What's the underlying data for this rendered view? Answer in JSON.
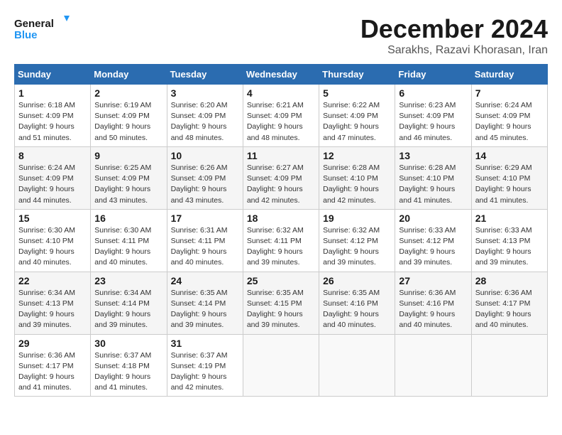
{
  "header": {
    "logo_line1": "General",
    "logo_line2": "Blue",
    "month": "December 2024",
    "location": "Sarakhs, Razavi Khorasan, Iran"
  },
  "weekdays": [
    "Sunday",
    "Monday",
    "Tuesday",
    "Wednesday",
    "Thursday",
    "Friday",
    "Saturday"
  ],
  "weeks": [
    [
      {
        "day": 1,
        "sunrise": "6:18 AM",
        "sunset": "4:09 PM",
        "daylight": "9 hours and 51 minutes."
      },
      {
        "day": 2,
        "sunrise": "6:19 AM",
        "sunset": "4:09 PM",
        "daylight": "9 hours and 50 minutes."
      },
      {
        "day": 3,
        "sunrise": "6:20 AM",
        "sunset": "4:09 PM",
        "daylight": "9 hours and 48 minutes."
      },
      {
        "day": 4,
        "sunrise": "6:21 AM",
        "sunset": "4:09 PM",
        "daylight": "9 hours and 48 minutes."
      },
      {
        "day": 5,
        "sunrise": "6:22 AM",
        "sunset": "4:09 PM",
        "daylight": "9 hours and 47 minutes."
      },
      {
        "day": 6,
        "sunrise": "6:23 AM",
        "sunset": "4:09 PM",
        "daylight": "9 hours and 46 minutes."
      },
      {
        "day": 7,
        "sunrise": "6:24 AM",
        "sunset": "4:09 PM",
        "daylight": "9 hours and 45 minutes."
      }
    ],
    [
      {
        "day": 8,
        "sunrise": "6:24 AM",
        "sunset": "4:09 PM",
        "daylight": "9 hours and 44 minutes."
      },
      {
        "day": 9,
        "sunrise": "6:25 AM",
        "sunset": "4:09 PM",
        "daylight": "9 hours and 43 minutes."
      },
      {
        "day": 10,
        "sunrise": "6:26 AM",
        "sunset": "4:09 PM",
        "daylight": "9 hours and 43 minutes."
      },
      {
        "day": 11,
        "sunrise": "6:27 AM",
        "sunset": "4:09 PM",
        "daylight": "9 hours and 42 minutes."
      },
      {
        "day": 12,
        "sunrise": "6:28 AM",
        "sunset": "4:10 PM",
        "daylight": "9 hours and 42 minutes."
      },
      {
        "day": 13,
        "sunrise": "6:28 AM",
        "sunset": "4:10 PM",
        "daylight": "9 hours and 41 minutes."
      },
      {
        "day": 14,
        "sunrise": "6:29 AM",
        "sunset": "4:10 PM",
        "daylight": "9 hours and 41 minutes."
      }
    ],
    [
      {
        "day": 15,
        "sunrise": "6:30 AM",
        "sunset": "4:10 PM",
        "daylight": "9 hours and 40 minutes."
      },
      {
        "day": 16,
        "sunrise": "6:30 AM",
        "sunset": "4:11 PM",
        "daylight": "9 hours and 40 minutes."
      },
      {
        "day": 17,
        "sunrise": "6:31 AM",
        "sunset": "4:11 PM",
        "daylight": "9 hours and 40 minutes."
      },
      {
        "day": 18,
        "sunrise": "6:32 AM",
        "sunset": "4:11 PM",
        "daylight": "9 hours and 39 minutes."
      },
      {
        "day": 19,
        "sunrise": "6:32 AM",
        "sunset": "4:12 PM",
        "daylight": "9 hours and 39 minutes."
      },
      {
        "day": 20,
        "sunrise": "6:33 AM",
        "sunset": "4:12 PM",
        "daylight": "9 hours and 39 minutes."
      },
      {
        "day": 21,
        "sunrise": "6:33 AM",
        "sunset": "4:13 PM",
        "daylight": "9 hours and 39 minutes."
      }
    ],
    [
      {
        "day": 22,
        "sunrise": "6:34 AM",
        "sunset": "4:13 PM",
        "daylight": "9 hours and 39 minutes."
      },
      {
        "day": 23,
        "sunrise": "6:34 AM",
        "sunset": "4:14 PM",
        "daylight": "9 hours and 39 minutes."
      },
      {
        "day": 24,
        "sunrise": "6:35 AM",
        "sunset": "4:14 PM",
        "daylight": "9 hours and 39 minutes."
      },
      {
        "day": 25,
        "sunrise": "6:35 AM",
        "sunset": "4:15 PM",
        "daylight": "9 hours and 39 minutes."
      },
      {
        "day": 26,
        "sunrise": "6:35 AM",
        "sunset": "4:16 PM",
        "daylight": "9 hours and 40 minutes."
      },
      {
        "day": 27,
        "sunrise": "6:36 AM",
        "sunset": "4:16 PM",
        "daylight": "9 hours and 40 minutes."
      },
      {
        "day": 28,
        "sunrise": "6:36 AM",
        "sunset": "4:17 PM",
        "daylight": "9 hours and 40 minutes."
      }
    ],
    [
      {
        "day": 29,
        "sunrise": "6:36 AM",
        "sunset": "4:17 PM",
        "daylight": "9 hours and 41 minutes."
      },
      {
        "day": 30,
        "sunrise": "6:37 AM",
        "sunset": "4:18 PM",
        "daylight": "9 hours and 41 minutes."
      },
      {
        "day": 31,
        "sunrise": "6:37 AM",
        "sunset": "4:19 PM",
        "daylight": "9 hours and 42 minutes."
      },
      null,
      null,
      null,
      null
    ]
  ]
}
